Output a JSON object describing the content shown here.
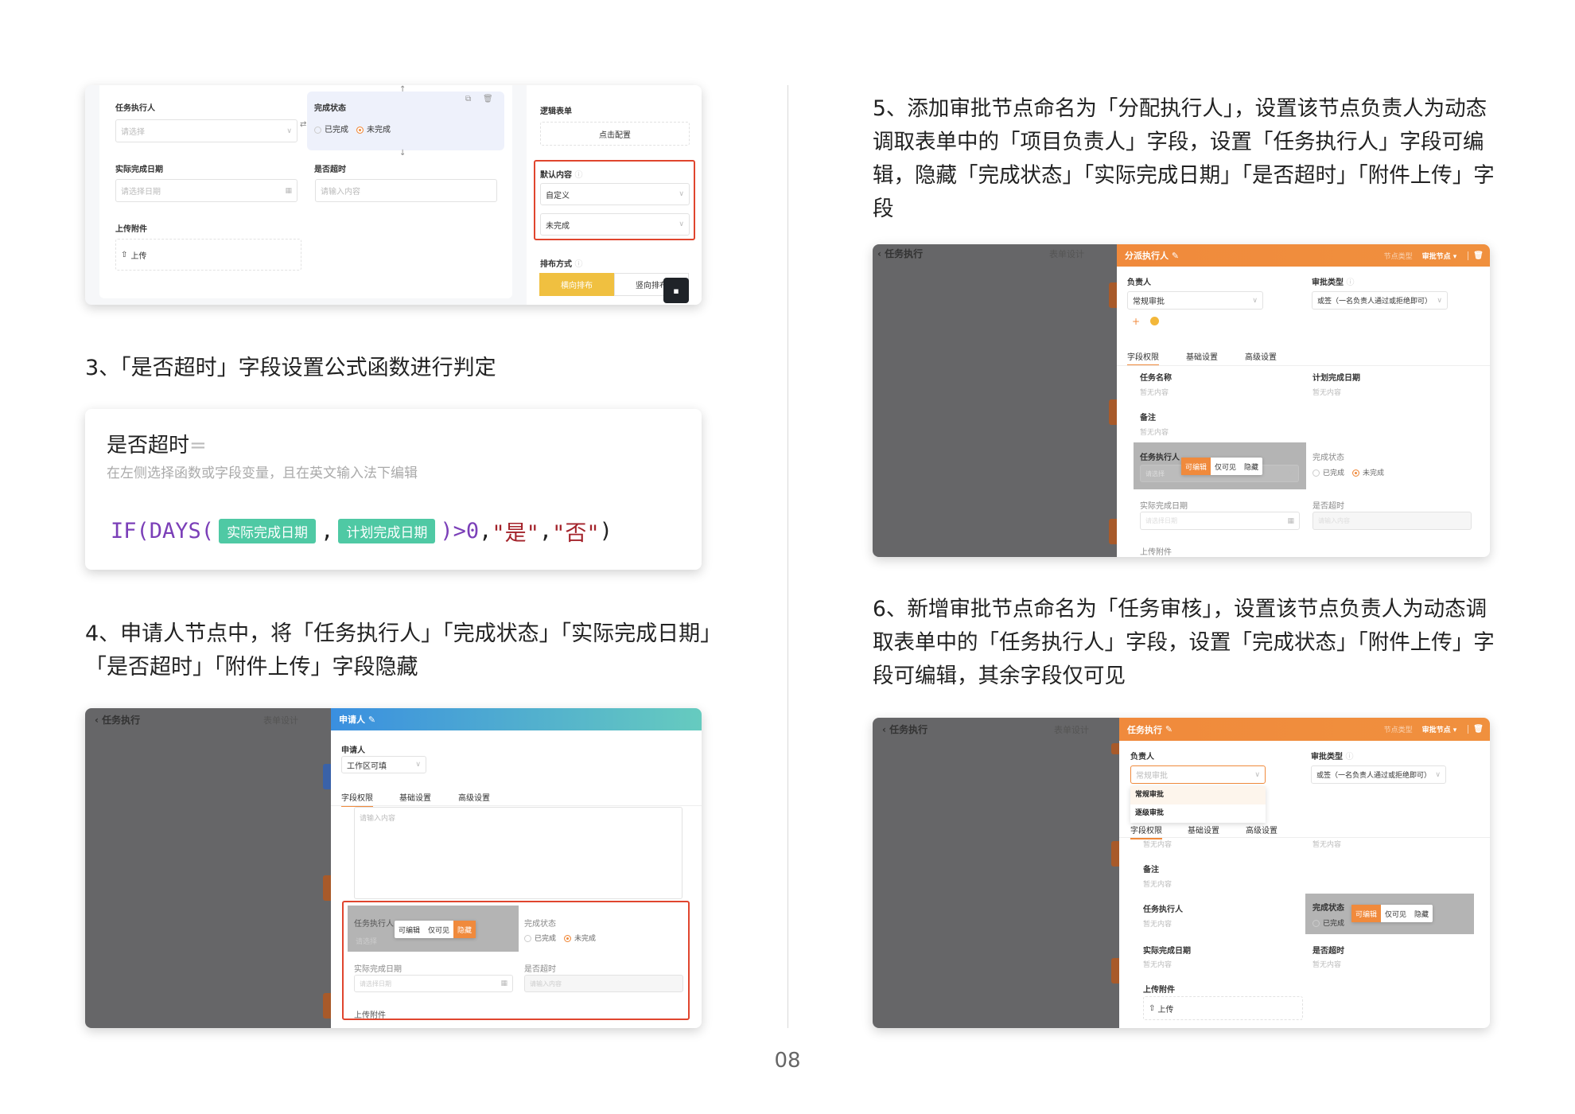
{
  "sc1": {
    "executor_label": "任务执行人",
    "executor_placeholder": "请选择",
    "status_label": "完成状态",
    "status_options": [
      "已完成",
      "未完成"
    ],
    "actual_date_label": "实际完成日期",
    "actual_date_placeholder": "请选择日期",
    "overdue_label": "是否超时",
    "overdue_placeholder": "请输入内容",
    "upload_label": "上传附件",
    "upload_button": "上传",
    "logic_form_label": "逻辑表单",
    "configure_button": "点击配置",
    "default_content_label": "默认内容",
    "default_type": "自定义",
    "default_value": "未完成",
    "layout_label": "排布方式",
    "layout_horizontal": "横向排布",
    "layout_vertical": "竖向排布"
  },
  "step3": "3、「是否超时」字段设置公式函数进行判定",
  "formula": {
    "title": "是否超时",
    "equals": "=",
    "hint": "在左侧选择函数或字段变量，且在英文输入法下编辑",
    "fn1": "IF(",
    "fn2": "DAYS(",
    "chip1": "实际完成日期",
    "comma": ",",
    "chip2": "计划完成日期",
    "compare": ")>0",
    "yes": "\"是\"",
    "no": "\"否\"",
    "close": ")"
  },
  "step4": "4、申请人节点中，将「任务执行人」「完成状态」「实际完成日期」「是否超时」「附件上传」字段隐藏",
  "sc4": {
    "back_title": "任务执行",
    "form_design_tab": "表单设计",
    "panel_title": "申请人",
    "applicant_label": "申请人",
    "applicant_value": "工作区可填",
    "tabs": [
      "字段权限",
      "基础设置",
      "高级设置"
    ],
    "textarea_placeholder": "请输入内容",
    "executor_label": "任务执行人",
    "executor_placeholder": "请选择",
    "perms": [
      "可编辑",
      "仅可见",
      "隐藏"
    ],
    "status_label": "完成状态",
    "status_options": [
      "已完成",
      "未完成"
    ],
    "actual_date_label": "实际完成日期",
    "actual_date_placeholder": "请选择日期",
    "overdue_label": "是否超时",
    "overdue_placeholder": "请输入内容",
    "upload_label": "上传附件"
  },
  "step5": "5、添加审批节点命名为「分配执行人」，设置该节点负责人为动态调取表单中的「项目负责人」字段，设置「任务执行人」字段可编辑，隐藏「完成状态」「实际完成日期」「是否超时」「附件上传」字段",
  "sc5": {
    "back_title": "任务执行",
    "form_design_tab": "表单设计",
    "panel_title": "分派执行人",
    "node_type_label": "节点类型",
    "node_type_value": "审批节点",
    "owner_label": "负责人",
    "owner_value": "常规审批",
    "approval_type_label": "审批类型",
    "approval_type_value": "或签（一名负责人通过或拒绝即可）",
    "tabs": [
      "字段权限",
      "基础设置",
      "高级设置"
    ],
    "task_name_label": "任务名称",
    "plan_date_label": "计划完成日期",
    "remark_label": "备注",
    "empty": "暂无内容",
    "executor_label": "任务执行人",
    "executor_placeholder": "请选择",
    "perms": [
      "可编辑",
      "仅可见",
      "隐藏"
    ],
    "status_label": "完成状态",
    "status_options": [
      "已完成",
      "未完成"
    ],
    "actual_date_label": "实际完成日期",
    "actual_date_placeholder": "请选择日期",
    "overdue_label": "是否超时",
    "overdue_placeholder": "请输入内容",
    "upload_label": "上传附件"
  },
  "step6": "6、新增审批节点命名为「任务审核」，设置该节点负责人为动态调取表单中的「任务执行人」字段，设置「完成状态」「附件上传」字段可编辑，其余字段仅可见",
  "sc6": {
    "back_title": "任务执行",
    "form_design_tab": "表单设计",
    "panel_title": "任务执行",
    "node_type_label": "节点类型",
    "node_type_value": "审批节点",
    "owner_label": "负责人",
    "owner_placeholder": "常规审批",
    "owner_options": [
      "常规审批",
      "逐级审批"
    ],
    "approval_type_label": "审批类型",
    "approval_type_value": "或签（一名负责人通过或拒绝即可）",
    "tabs": [
      "字段权限",
      "基础设置",
      "高级设置"
    ],
    "empty": "暂无内容",
    "remark_label": "备注",
    "executor_label": "任务执行人",
    "status_label": "完成状态",
    "status_option": "已完成",
    "perms": [
      "可编辑",
      "仅可见",
      "隐藏"
    ],
    "actual_date_label": "实际完成日期",
    "overdue_label": "是否超时",
    "upload_label": "上传附件",
    "upload_button": "上传"
  },
  "page_number": "08",
  "colors": {
    "accent": "#f08a3c",
    "highlight_red": "#e0452e",
    "chip_green": "#4fc9a4",
    "formula_purple": "#7b3fb8",
    "formula_red": "#a3222a"
  }
}
